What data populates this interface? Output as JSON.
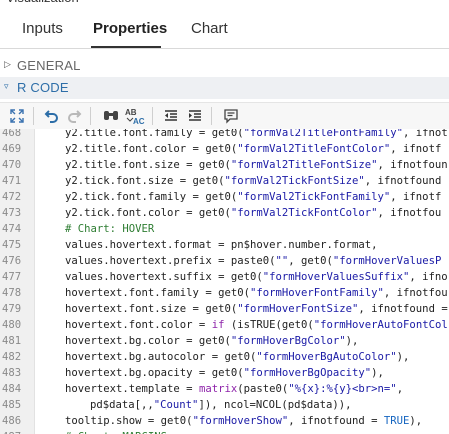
{
  "header": {
    "title": "Visualization"
  },
  "tabs": [
    {
      "label": "Inputs",
      "active": false
    },
    {
      "label": "Properties",
      "active": true
    },
    {
      "label": "Chart",
      "active": false
    }
  ],
  "sections": [
    {
      "label": "GENERAL",
      "expanded": false
    },
    {
      "label": "R CODE",
      "expanded": true
    }
  ],
  "toolbar": {
    "buttons": [
      "fullscreen-icon",
      "undo-icon",
      "redo-icon",
      "find-icon",
      "replace-icon",
      "outdent-icon",
      "indent-icon",
      "comment-icon"
    ]
  },
  "colors": {
    "active_section_text": "#2d6ea8",
    "active_section_bg": "#eef0f3",
    "string": "#1a1aa6",
    "comment": "#2e7d32",
    "keyword": "#8e24aa"
  },
  "editor": {
    "lines": [
      {
        "num": "468",
        "text": "    y2.title.font.family = get0(\"formVal2TitleFontFamily\", ifnot"
      },
      {
        "num": "469",
        "text": "    y2.title.font.color = get0(\"formVal2TitleFontColor\", ifnotf"
      },
      {
        "num": "470",
        "text": "    y2.title.font.size = get0(\"formVal2TitleFontSize\", ifnotfoun"
      },
      {
        "num": "471",
        "text": "    y2.tick.font.size = get0(\"formVal2TickFontSize\", ifnotfound"
      },
      {
        "num": "472",
        "text": "    y2.tick.font.family = get0(\"formVal2TickFontFamily\", ifnotf"
      },
      {
        "num": "473",
        "text": "    y2.tick.font.color = get0(\"formVal2TickFontColor\", ifnotfou"
      },
      {
        "num": "474",
        "text": "    # Chart: HOVER"
      },
      {
        "num": "475",
        "text": "    values.hovertext.format = pn$hover.number.format,"
      },
      {
        "num": "476",
        "text": "    values.hovertext.prefix = paste0(\"\", get0(\"formHoverValuesP"
      },
      {
        "num": "477",
        "text": "    values.hovertext.suffix = get0(\"formHoverValuesSuffix\", ifno"
      },
      {
        "num": "478",
        "text": "    hovertext.font.family = get0(\"formHoverFontFamily\", ifnotfou"
      },
      {
        "num": "479",
        "text": "    hovertext.font.size = get0(\"formHoverFontSize\", ifnotfound ="
      },
      {
        "num": "480",
        "text": "    hovertext.font.color = if (isTRUE(get0(\"formHoverAutoFontCol"
      },
      {
        "num": "481",
        "text": "    hovertext.bg.color = get0(\"formHoverBgColor\"),"
      },
      {
        "num": "482",
        "text": "    hovertext.bg.autocolor = get0(\"formHoverBgAutoColor\"),"
      },
      {
        "num": "483",
        "text": "    hovertext.bg.opacity = get0(\"formHoverBgOpacity\"),"
      },
      {
        "num": "484",
        "text": "    hovertext.template = matrix(paste0(\"%{x}:%{y}<br>n=\","
      },
      {
        "num": "485",
        "text": "        pd$data[,,\"Count\"]), ncol=NCOL(pd$data)),"
      },
      {
        "num": "486",
        "text": "    tooltip.show = get0(\"formHoverShow\", ifnotfound = TRUE),"
      },
      {
        "num": "487",
        "text": "    # Chart: MARGINS"
      }
    ]
  }
}
